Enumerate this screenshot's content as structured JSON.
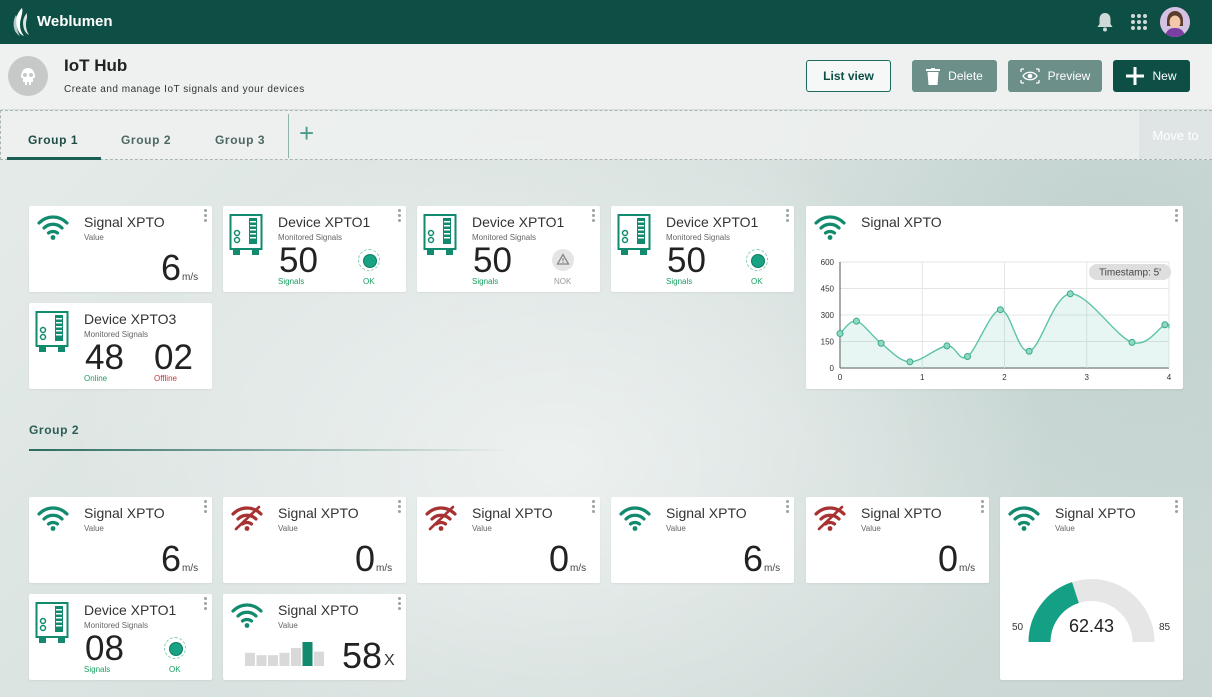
{
  "brand": {
    "name": "Weblumen"
  },
  "header": {
    "title": "IoT Hub",
    "subtitle": "Create and manage IoT signals and your devices",
    "list_view": "List view",
    "delete": "Delete",
    "preview": "Preview",
    "new": "New"
  },
  "tabs": {
    "items": [
      "Group 1",
      "Group 2",
      "Group 3"
    ],
    "active": "Group 1",
    "move_to": "Move to"
  },
  "group1": {
    "signal": {
      "title": "Signal XPTO",
      "sub": "Value",
      "value": "6",
      "unit": "m/s"
    },
    "devices": [
      {
        "title": "Device XPTO1",
        "sub": "Monitored Signals",
        "value": "50",
        "count_label": "Signals",
        "status": "OK"
      },
      {
        "title": "Device XPTO1",
        "sub": "Monitored Signals",
        "value": "50",
        "count_label": "Signals",
        "status": "NOK"
      },
      {
        "title": "Device XPTO1",
        "sub": "Monitored Signals",
        "value": "50",
        "count_label": "Signals",
        "status": "OK"
      }
    ],
    "device3": {
      "title": "Device XPTO3",
      "sub": "Monitored Signals",
      "online": "48",
      "online_label": "Online",
      "offline": "02",
      "offline_label": "Offline"
    },
    "chart_title": "Signal XPTO",
    "timestamp": "Timestamp: 5'"
  },
  "chart_data": {
    "type": "area",
    "x": [
      0,
      0.2,
      0.5,
      0.85,
      1.3,
      1.55,
      1.95,
      2.3,
      2.8,
      3.55,
      3.95
    ],
    "y": [
      195,
      265,
      140,
      35,
      125,
      65,
      330,
      95,
      420,
      145,
      245
    ],
    "xlim": [
      0,
      4
    ],
    "ylim": [
      0,
      600
    ],
    "xticks": [
      0,
      1,
      2,
      3,
      4
    ],
    "yticks": [
      0,
      150,
      300,
      450,
      600
    ],
    "grid": true,
    "color": "#5cc3a8"
  },
  "group2": {
    "label": "Group 2",
    "signals": [
      {
        "title": "Signal XPTO",
        "sub": "Value",
        "value": "6",
        "unit": "m/s",
        "online": true
      },
      {
        "title": "Signal XPTO",
        "sub": "Value",
        "value": "0",
        "unit": "m/s",
        "online": false
      },
      {
        "title": "Signal XPTO",
        "sub": "Value",
        "value": "0",
        "unit": "m/s",
        "online": false
      },
      {
        "title": "Signal XPTO",
        "sub": "Value",
        "value": "6",
        "unit": "m/s",
        "online": true
      },
      {
        "title": "Signal XPTO",
        "sub": "Value",
        "value": "0",
        "unit": "m/s",
        "online": false
      }
    ],
    "device": {
      "title": "Device XPTO1",
      "sub": "Monitored Signals",
      "value": "08",
      "count_label": "Signals",
      "status": "OK"
    },
    "bar_signal": {
      "title": "Signal XPTO",
      "sub": "Value",
      "value": "58",
      "unit": "X",
      "levels": [
        0.55,
        0.45,
        0.45,
        0.55,
        0.75,
        1.0,
        0.6
      ],
      "active_index": 5
    },
    "gauge": {
      "title": "Signal XPTO",
      "sub": "Value",
      "value": "62.43",
      "min": "50",
      "max": "85",
      "fraction": 0.4
    }
  },
  "colors": {
    "brand": "#0e4f45",
    "ok": "#17a383",
    "error": "#a83232",
    "accent": "#5cc3a8"
  }
}
